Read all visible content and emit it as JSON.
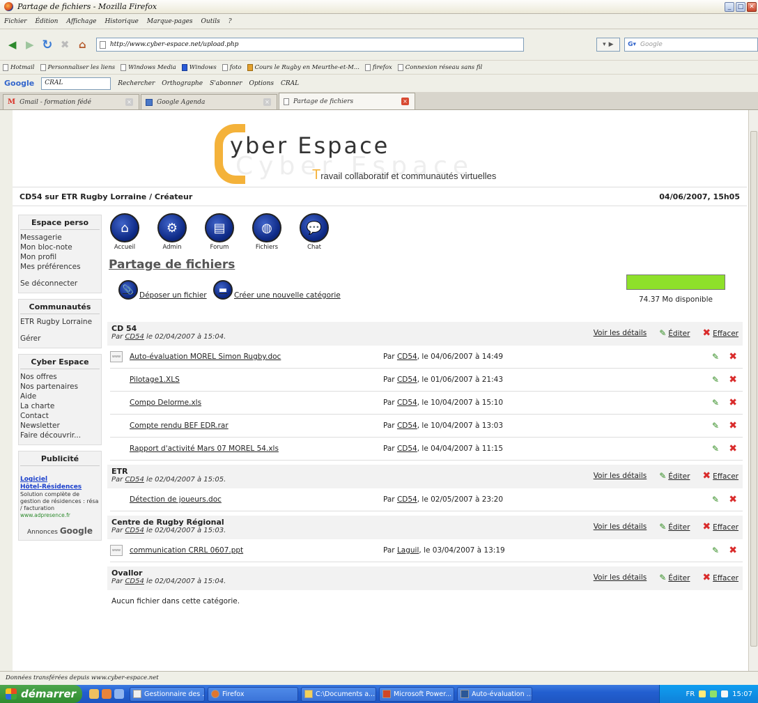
{
  "window": {
    "title": "Partage de fichiers - Mozilla Firefox"
  },
  "menu": [
    "Fichier",
    "Édition",
    "Affichage",
    "Historique",
    "Marque-pages",
    "Outils",
    "?"
  ],
  "url": "http://www.cyber-espace.net/upload.php",
  "search_placeholder": "Google",
  "bookmarks": [
    "Hotmail",
    "Personnaliser les liens",
    "Windows Media",
    "Windows",
    "foto",
    "Cours le Rugby en Meurthe-et-M...",
    "firefox",
    "Connexion réseau sans fil"
  ],
  "googlebar": {
    "logo": "Google",
    "query": "CRAL",
    "items": [
      "Rechercher",
      "Orthographe",
      "S'abonner",
      "Options",
      "CRAL"
    ]
  },
  "tabs": [
    {
      "label": "Gmail - formation fédé",
      "icon": "gmail-icon"
    },
    {
      "label": "Google Agenda",
      "icon": "calendar-icon"
    },
    {
      "label": "Partage de fichiers",
      "icon": "page-icon",
      "active": true
    }
  ],
  "site": {
    "brand": "yber Espace",
    "brand_initial": "C",
    "ghost": "Cyber Espace",
    "tagline_initial": "T",
    "tagline": "ravail collaboratif et communautés virtuelles",
    "breadcrumb": "CD54 sur ETR Rugby Lorraine / Créateur",
    "datetime": "04/06/2007, 15h05"
  },
  "sidebar": {
    "perso": {
      "title": "Espace perso",
      "items": [
        "Messagerie",
        "Mon bloc-note",
        "Mon profil",
        "Mes préférences"
      ],
      "logout": "Se déconnecter"
    },
    "communautes": {
      "title": "Communautés",
      "items": [
        "ETR Rugby Lorraine"
      ],
      "manage": "Gérer"
    },
    "cyber": {
      "title": "Cyber Espace",
      "items": [
        "Nos offres",
        "Nos partenaires",
        "Aide",
        "La charte",
        "Contact",
        "Newsletter",
        "Faire découvrir..."
      ]
    },
    "pub": {
      "title": "Publicité",
      "ad_title_1": "Logiciel",
      "ad_title_2": "Hôtel-Résidences",
      "ad_desc": "Solution complète de gestion de résidences : résa / facturation",
      "ad_url": "www.adpresence.fr",
      "ads_by": "Annonces",
      "ads_brand": "Google"
    }
  },
  "nav_icons": [
    {
      "label": "Accueil",
      "icon": "home-icon"
    },
    {
      "label": "Admin",
      "icon": "gears-icon"
    },
    {
      "label": "Forum",
      "icon": "document-icon"
    },
    {
      "label": "Fichiers",
      "icon": "globe-icon"
    },
    {
      "label": "Chat",
      "icon": "chat-bubbles-icon"
    }
  ],
  "page_title": "Partage de fichiers",
  "actions": {
    "upload": "Déposer un fichier",
    "new_category": "Créer une nouvelle catégorie"
  },
  "quota": {
    "text": "74.37 Mo disponible",
    "fill_fraction": 1.0
  },
  "labels": {
    "details": "Voir les détails",
    "edit": "Éditer",
    "delete": "Effacer",
    "by": "Par",
    "empty": "Aucun fichier dans cette catégorie."
  },
  "categories": [
    {
      "name": "CD 54",
      "author": "CD54",
      "created": "le 02/04/2007 à 15:04.",
      "files": [
        {
          "name": "Auto-évaluation MOREL Simon Rugby.doc",
          "author": "CD54",
          "date": ", le 04/06/2007 à 14:49",
          "has_icon": true
        },
        {
          "name": "Pilotage1.XLS",
          "author": "CD54",
          "date": ", le 01/06/2007 à 21:43",
          "has_icon": false
        },
        {
          "name": "Compo Delorme.xls",
          "author": "CD54",
          "date": ", le 10/04/2007 à 15:10",
          "has_icon": false
        },
        {
          "name": "Compte rendu BEF EDR.rar",
          "author": "CD54",
          "date": ", le 10/04/2007 à 13:03",
          "has_icon": false
        },
        {
          "name": "Rapport d'activité Mars 07 MOREL 54.xls",
          "author": "CD54",
          "date": ", le 04/04/2007 à 11:15",
          "has_icon": false
        }
      ]
    },
    {
      "name": "ETR",
      "author": "CD54",
      "created": "le 02/04/2007 à 15:05.",
      "files": [
        {
          "name": "Détection de joueurs.doc",
          "author": "CD54",
          "date": ", le 02/05/2007 à 23:20",
          "has_icon": false
        }
      ]
    },
    {
      "name": "Centre de Rugby Régional",
      "author": "CD54",
      "created": "le 02/04/2007 à 15:03.",
      "files": [
        {
          "name": "communication CRRL 0607.ppt",
          "author": "Laguil",
          "date": ", le 03/04/2007 à 13:19",
          "has_icon": true
        }
      ]
    },
    {
      "name": "Ovallor",
      "author": "CD54",
      "created": "le 02/04/2007 à 15:04.",
      "files": []
    }
  ],
  "statusbar": "Données transférées depuis www.cyber-espace.net",
  "taskbar": {
    "start": "démarrer",
    "items": [
      "Gestionnaire des ...",
      "Firefox",
      "C:\\Documents a...",
      "Microsoft Power...",
      "Auto-évaluation ..."
    ],
    "lang": "FR",
    "clock": "15:07"
  }
}
